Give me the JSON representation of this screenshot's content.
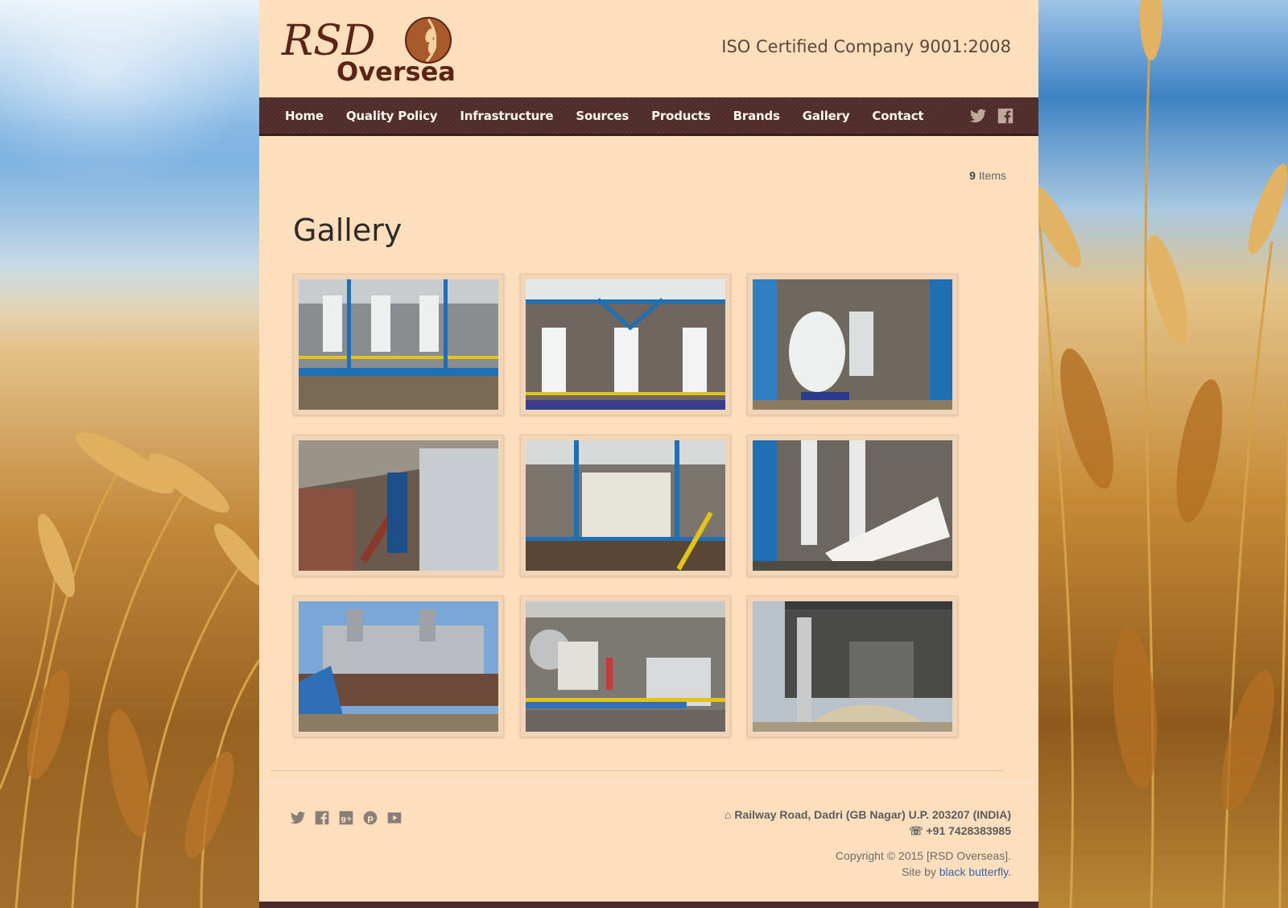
{
  "background": {
    "description_colors": {
      "sky": "#7fb3df",
      "wheat": "#c88c3a"
    }
  },
  "header": {
    "logo": {
      "line1": "RSD",
      "line2": "Overseas"
    },
    "tagline": "ISO Certified Company 9001:2008"
  },
  "nav": {
    "items": [
      "Home",
      "Quality Policy",
      "Infrastructure",
      "Sources",
      "Products",
      "Brands",
      "Gallery",
      "Contact"
    ],
    "social": [
      "twitter-icon",
      "facebook-icon"
    ]
  },
  "main": {
    "count_number": "9",
    "count_label": " Items",
    "title": "Gallery",
    "thumbnails": [
      {
        "name": "gallery-thumb-1"
      },
      {
        "name": "gallery-thumb-2"
      },
      {
        "name": "gallery-thumb-3"
      },
      {
        "name": "gallery-thumb-4"
      },
      {
        "name": "gallery-thumb-5"
      },
      {
        "name": "gallery-thumb-6"
      },
      {
        "name": "gallery-thumb-7"
      },
      {
        "name": "gallery-thumb-8"
      },
      {
        "name": "gallery-thumb-9"
      }
    ]
  },
  "footer": {
    "social": [
      "twitter-icon",
      "facebook-icon",
      "google-plus-icon",
      "pinterest-icon",
      "youtube-icon"
    ],
    "address": "Railway Road, Dadri (GB Nagar) U.P. 203207 (INDIA)",
    "phone": "+91 7428383985",
    "copyright": "Copyright © 2015 [RSD Overseas].",
    "site_by_prefix": "Site by ",
    "site_by_link": "black butterfly",
    "site_by_suffix": "."
  },
  "colors": {
    "page_bg": "#fedfbd",
    "nav_bg": "#563331",
    "link": "#3d63a8",
    "logo_brown": "#5a2417"
  }
}
